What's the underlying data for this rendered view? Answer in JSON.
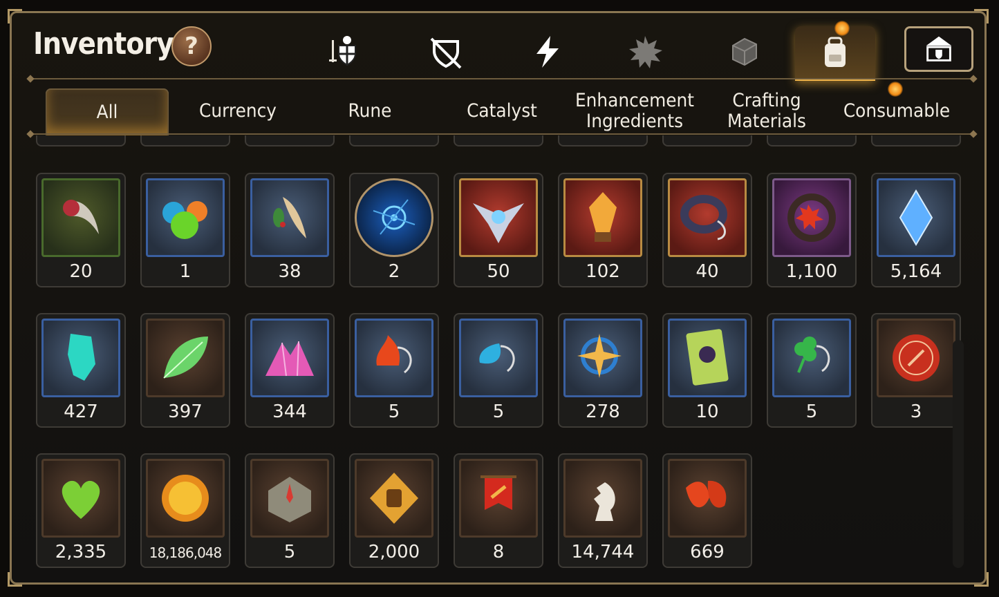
{
  "header": {
    "title": "Inventory",
    "help_label": "?"
  },
  "category_tabs": [
    {
      "icon": "sword-shield-icon"
    },
    {
      "icon": "crossed-shield-icon"
    },
    {
      "icon": "lightning-icon"
    },
    {
      "icon": "splatter-icon"
    },
    {
      "icon": "cube-icon"
    },
    {
      "icon": "backpack-icon",
      "active": true
    }
  ],
  "top_right_button": {
    "icon": "guild-hall-icon"
  },
  "sub_tabs": [
    {
      "label": "All",
      "active": true
    },
    {
      "label": "Currency"
    },
    {
      "label": "Rune"
    },
    {
      "label": "Catalyst"
    },
    {
      "label": "Enhancement\nIngredients"
    },
    {
      "label": "Crafting\nMaterials"
    },
    {
      "label": "Consumable"
    }
  ],
  "items": [
    {
      "icon": "claw-icon",
      "count": "20"
    },
    {
      "icon": "slime-orbs-icon",
      "count": "1"
    },
    {
      "icon": "herb-root-icon",
      "count": "38"
    },
    {
      "icon": "rune-disc-icon",
      "count": "2"
    },
    {
      "icon": "winged-eye-icon",
      "count": "50"
    },
    {
      "icon": "golden-crystal-icon",
      "count": "102"
    },
    {
      "icon": "dark-ring-icon",
      "count": "40"
    },
    {
      "icon": "red-flower-amulet-icon",
      "count": "1,100"
    },
    {
      "icon": "blue-crystal-icon",
      "count": "5,164"
    },
    {
      "icon": "teal-crystal-icon",
      "count": "427"
    },
    {
      "icon": "green-leaf-icon",
      "count": "397"
    },
    {
      "icon": "pink-crystal-cluster-icon",
      "count": "344"
    },
    {
      "icon": "fire-pendant-icon",
      "count": "5"
    },
    {
      "icon": "water-pendant-icon",
      "count": "5"
    },
    {
      "icon": "star-pendant-icon",
      "count": "278"
    },
    {
      "icon": "card-icon",
      "count": "10"
    },
    {
      "icon": "clover-pendant-icon",
      "count": "5"
    },
    {
      "icon": "red-seal-badge-icon",
      "count": "3"
    },
    {
      "icon": "green-heart-icon",
      "count": "2,335"
    },
    {
      "icon": "gold-coin-icon",
      "count": "18,186,048"
    },
    {
      "icon": "compass-stone-icon",
      "count": "5"
    },
    {
      "icon": "fist-emblem-icon",
      "count": "2,000"
    },
    {
      "icon": "red-banner-icon",
      "count": "8"
    },
    {
      "icon": "chess-knight-icon",
      "count": "14,744"
    },
    {
      "icon": "autumn-leaf-icon",
      "count": "669"
    }
  ],
  "colors": {
    "accent": "#f0b44a",
    "frame": "#8a7652",
    "tile_border": "#3e3b36"
  }
}
